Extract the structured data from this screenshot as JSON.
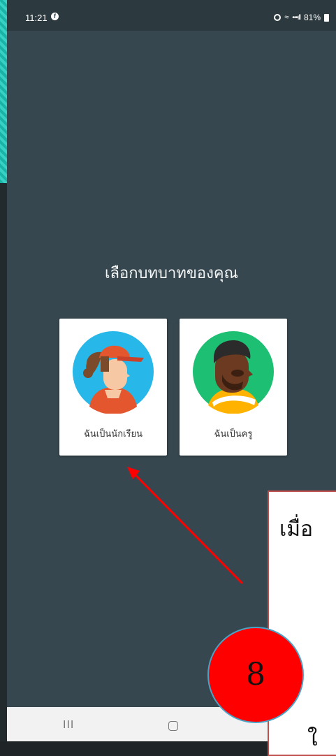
{
  "status_bar": {
    "time": "11:21",
    "facebook_icon": "f",
    "wifi": "≈",
    "signal": "•••ıll",
    "battery": "81%"
  },
  "screen": {
    "heading": "เลือกบทบาทของคุณ",
    "roles": [
      {
        "label": "ฉันเป็นนักเรียน",
        "icon": "student-avatar-icon"
      },
      {
        "label": "ฉันเป็นครู",
        "icon": "teacher-avatar-icon"
      }
    ]
  },
  "nav_bar": {
    "recents": "III"
  },
  "annotation": {
    "callout_line1": "เมื่อ",
    "callout_line2": "ใ",
    "step_number": "8",
    "arrow_color": "#ff0000",
    "circle_color": "#ff0000"
  }
}
